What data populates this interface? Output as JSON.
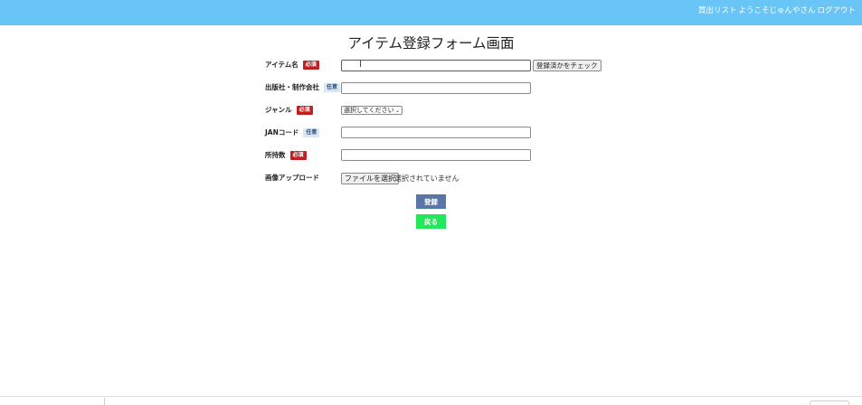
{
  "header": {
    "purchase_list_link": "買出リスト",
    "welcome_text": "ようこそじゅんやさん",
    "logout_link": "ログアウト",
    "background_color": "#69c5f6"
  },
  "page_title": "アイテム登録フォーム画面",
  "form": {
    "item_name": {
      "label": "アイテム名",
      "badge": "必須",
      "value": ""
    },
    "check_button": "登録済かをチェック",
    "publisher": {
      "label": "出版社・制作会社",
      "badge": "任意",
      "value": ""
    },
    "genre": {
      "label": "ジャンル",
      "badge": "必須",
      "selected": "選択してください"
    },
    "jan_code": {
      "label": "JANコード",
      "badge": "任意",
      "value": ""
    },
    "quantity": {
      "label": "所持数",
      "badge": "必須",
      "value": ""
    },
    "image_upload": {
      "label": "画像アップロード",
      "file_button": "ファイルを選択",
      "file_status": "選択されていません"
    }
  },
  "buttons": {
    "register": "登録",
    "back": "戻る"
  },
  "colors": {
    "required_badge": "#c0201f",
    "optional_badge": "#d9e7f5",
    "register_button": "#5a76a6",
    "back_button": "#22e85a"
  }
}
